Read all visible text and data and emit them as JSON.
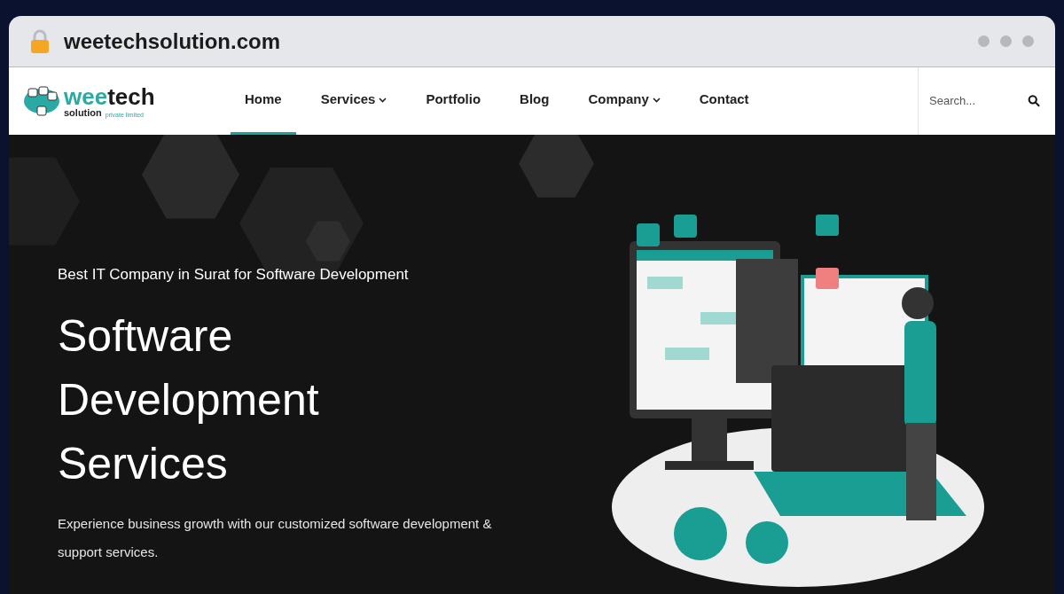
{
  "browser": {
    "url": "weetechsolution.com"
  },
  "logo": {
    "brand_first": "wee",
    "brand_second": "tech",
    "tagline": "solution",
    "tagline_small": "private limited"
  },
  "nav": [
    {
      "label": "Home",
      "selected": true,
      "dropdown": false
    },
    {
      "label": "Services",
      "selected": false,
      "dropdown": true
    },
    {
      "label": "Portfolio",
      "selected": false,
      "dropdown": false
    },
    {
      "label": "Blog",
      "selected": false,
      "dropdown": false
    },
    {
      "label": "Company",
      "selected": false,
      "dropdown": true
    },
    {
      "label": "Contact",
      "selected": false,
      "dropdown": false
    }
  ],
  "search": {
    "placeholder": "Search..."
  },
  "hero": {
    "eyebrow": "Best IT Company in Surat for Software Development",
    "title": "Software Development Services",
    "description": "Experience business growth with our customized software development & support services."
  }
}
